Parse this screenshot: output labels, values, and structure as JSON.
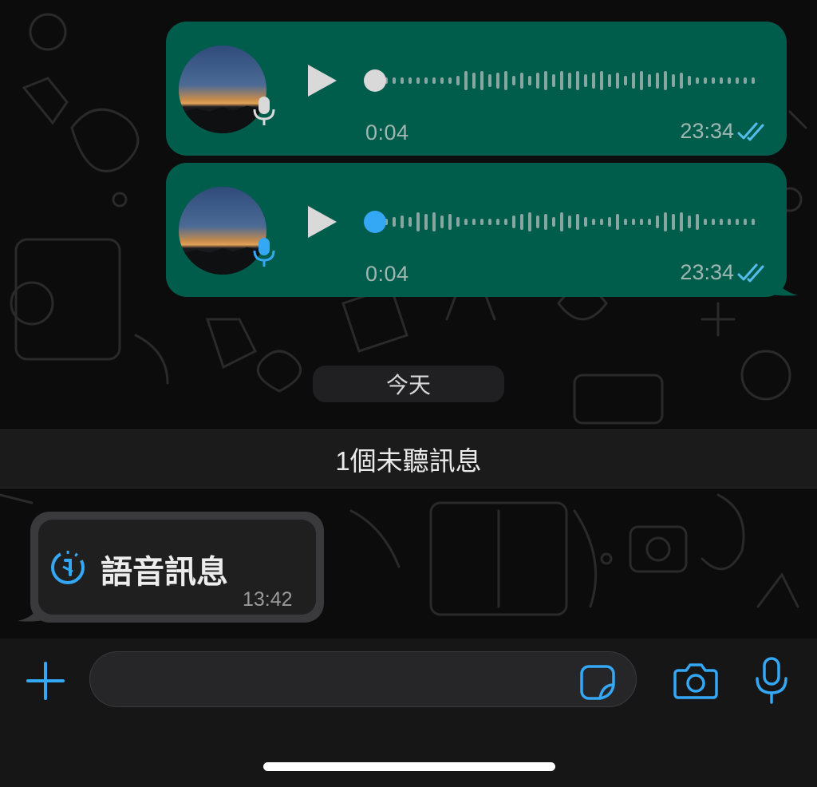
{
  "messages": {
    "outgoing": [
      {
        "duration": "0:04",
        "time": "23:34",
        "played": true
      },
      {
        "duration": "0:04",
        "time": "23:34",
        "played": false
      }
    ],
    "date_separator": "今天",
    "unread_banner": "1個未聽訊息",
    "incoming": {
      "label": "語音訊息",
      "time": "13:42"
    }
  },
  "composer": {
    "placeholder": ""
  },
  "icons": {
    "attach": "plus-icon",
    "sticker": "sticker-icon",
    "camera": "camera-icon",
    "voice": "microphone-icon",
    "status": "double-check-icon",
    "view_once": "view-once-icon"
  },
  "colors": {
    "outgoing_bubble": "#005c4b",
    "accent_blue": "#34a7f5",
    "played_grey": "#d9d9d9",
    "read_ticks": "#53bdeb"
  }
}
